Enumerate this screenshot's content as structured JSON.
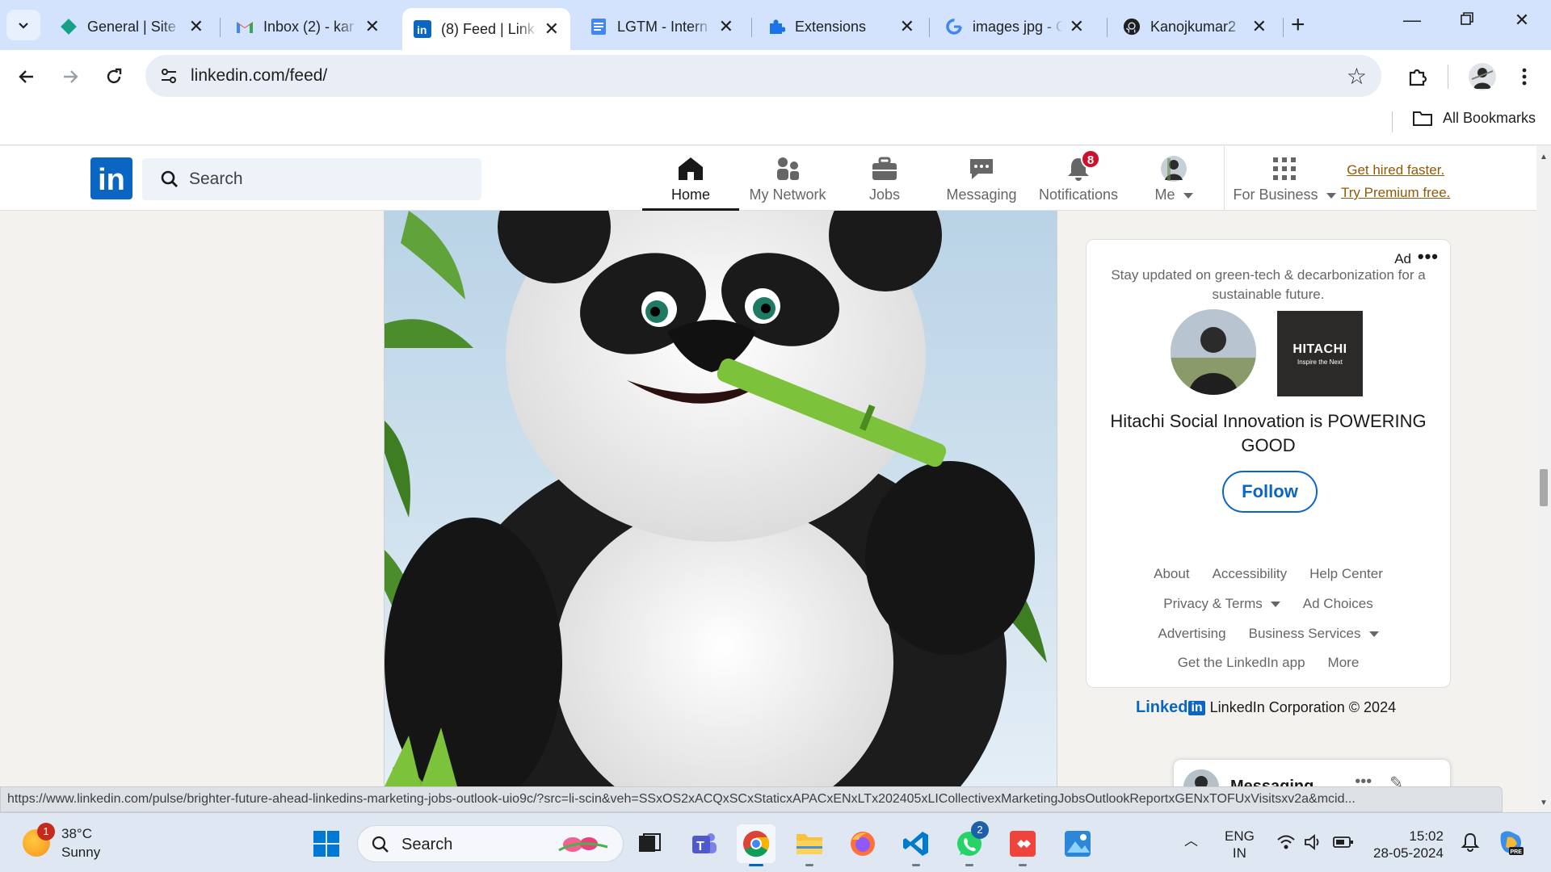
{
  "browser": {
    "tabs": [
      {
        "title": "General | Site",
        "icon": "site-diamond-icon",
        "active": false
      },
      {
        "title": "Inbox (2) - kar",
        "icon": "gmail-icon",
        "active": false
      },
      {
        "title": "(8) Feed | Link",
        "icon": "linkedin-icon",
        "active": true
      },
      {
        "title": "LGTM - Intern",
        "icon": "docs-icon",
        "active": false
      },
      {
        "title": "Extensions",
        "icon": "puzzle-icon",
        "active": false
      },
      {
        "title": "images jpg - G",
        "icon": "google-icon",
        "active": false
      },
      {
        "title": "Kanojkumar2",
        "icon": "github-icon",
        "active": false
      }
    ],
    "url": "linkedin.com/feed/",
    "bookmarks_label": "All Bookmarks",
    "status_url": "https://www.linkedin.com/pulse/brighter-future-ahead-linkedins-marketing-jobs-outlook-uio9c/?src=li-scin&veh=SSxOS2xACQxSCxStaticxAPACxENxLTx202405xLICollectivexMarketingJobsOutlookReportxGENxTOFUxVisitsxv2a&mcid..."
  },
  "linkedin": {
    "search_placeholder": "Search",
    "nav": [
      {
        "label": "Home",
        "icon": "home-icon",
        "active": true
      },
      {
        "label": "My Network",
        "icon": "network-icon",
        "active": false
      },
      {
        "label": "Jobs",
        "icon": "briefcase-icon",
        "active": false
      },
      {
        "label": "Messaging",
        "icon": "chat-icon",
        "active": false
      },
      {
        "label": "Notifications",
        "icon": "bell-icon",
        "active": false,
        "badge": "8"
      },
      {
        "label": "Me",
        "icon": "avatar",
        "active": false
      }
    ],
    "for_business": "For Business",
    "premium_line1": "Get hired faster.",
    "premium_line2": "Try Premium free.",
    "ad": {
      "label": "Ad",
      "description": "Stay updated on green-tech & decarbonization for a sustainable future.",
      "company_logo_text": "HITACHI",
      "company_logo_sub": "Inspire the Next",
      "headline": "Hitachi Social Innovation is POWERING GOOD",
      "follow_label": "Follow"
    },
    "footer": {
      "about": "About",
      "accessibility": "Accessibility",
      "help_center": "Help Center",
      "privacy_terms": "Privacy & Terms",
      "ad_choices": "Ad Choices",
      "advertising": "Advertising",
      "business_services": "Business Services",
      "get_app": "Get the LinkedIn app",
      "more": "More",
      "brand_word": "Linked",
      "brand_box": "in",
      "copyright": "LinkedIn Corporation © 2024"
    },
    "messaging_label": "Messaging"
  },
  "taskbar": {
    "weather_temp": "38°C",
    "weather_cond": "Sunny",
    "weather_badge": "1",
    "search_placeholder": "Search",
    "whatsapp_badge": "2",
    "lang_line1": "ENG",
    "lang_line2": "IN",
    "time": "15:02",
    "date": "28-05-2024"
  },
  "colors": {
    "linkedin_blue": "#0a66c2",
    "premium_gold": "#915907",
    "badge_red": "#cb112d",
    "tab_strip": "#d3e3fd"
  }
}
